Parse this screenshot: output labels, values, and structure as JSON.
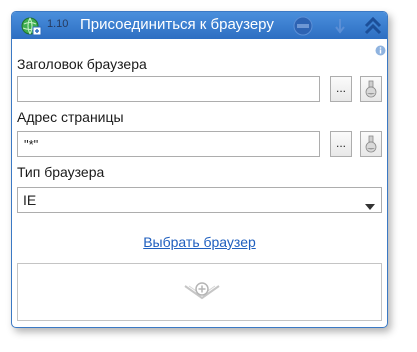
{
  "header": {
    "version": "1.10",
    "title": "Присоединиться к браузеру",
    "icons": [
      "activity-globe-icon",
      "record-icon",
      "arrow-down-icon",
      "collapse-chevrons-icon"
    ]
  },
  "fields": {
    "browser_title": {
      "label": "Заголовок браузера",
      "value": "",
      "browse_label": "..."
    },
    "page_url": {
      "label": "Адрес страницы",
      "value": "\"*\"",
      "browse_label": "..."
    },
    "browser_type": {
      "label": "Тип браузера",
      "value": "IE"
    }
  },
  "select_browser_link": "Выбрать браузер",
  "drop_zone": {
    "icon": "add-activity-icon"
  },
  "colors": {
    "header": "#3a7dd0",
    "border": "#3b79c4",
    "link": "#1f5fbf"
  }
}
